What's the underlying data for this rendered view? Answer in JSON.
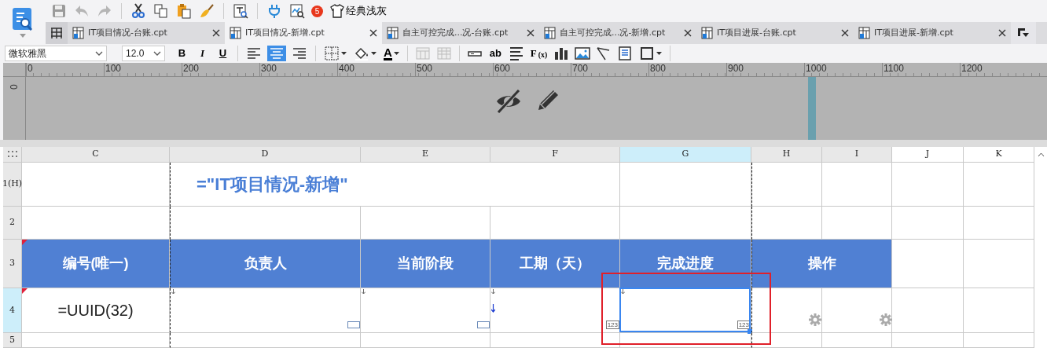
{
  "toolbar": {
    "notification_count": "5",
    "theme_button": "经典浅灰"
  },
  "tabs": [
    {
      "label": "IT项目情况-台账.cpt",
      "selected": false
    },
    {
      "label": "IT项目情况-新增.cpt",
      "selected": true
    },
    {
      "label": "自主可控完成...况-台账.cpt",
      "selected": false
    },
    {
      "label": "自主可控完成...况-新增.cpt",
      "selected": false
    },
    {
      "label": "IT项目进展-台账.cpt",
      "selected": false
    },
    {
      "label": "IT项目进展-新增.cpt",
      "selected": false
    }
  ],
  "format_bar": {
    "font": "微软雅黑",
    "size": "12.0",
    "style_buttons": [
      "B",
      "I",
      "U"
    ],
    "alignment": [
      {
        "kind": "left",
        "selected": false
      },
      {
        "kind": "center",
        "selected": true
      },
      {
        "kind": "right",
        "selected": false
      }
    ],
    "font_color_button": "A",
    "text_button": "ab",
    "formula_button": "F$_{(x)}$"
  },
  "ruler": {
    "horizontal": [
      "0",
      "100",
      "200",
      "300",
      "400",
      "500",
      "600",
      "700",
      "800",
      "900",
      "1000",
      "1100",
      "1200"
    ],
    "vertical": [
      "0"
    ]
  },
  "sheet": {
    "columns": [
      {
        "label": "C",
        "selected": false,
        "shaded": true
      },
      {
        "label": "D",
        "selected": false,
        "shaded": true
      },
      {
        "label": "E",
        "selected": false,
        "shaded": true
      },
      {
        "label": "F",
        "selected": false,
        "shaded": true
      },
      {
        "label": "G",
        "selected": true,
        "shaded": true
      },
      {
        "label": "H",
        "selected": false,
        "shaded": true
      },
      {
        "label": "I",
        "selected": false,
        "shaded": true
      },
      {
        "label": "J",
        "selected": false,
        "shaded": false
      },
      {
        "label": "K",
        "selected": false,
        "shaded": false
      }
    ],
    "rows": [
      {
        "label": "1(H)",
        "selected": false
      },
      {
        "label": "2",
        "selected": false
      },
      {
        "label": "3",
        "selected": false
      },
      {
        "label": "4",
        "selected": true
      },
      {
        "label": "5",
        "selected": false
      }
    ],
    "title": "=\"IT项目情况-新增\"",
    "headers": [
      "编号(唯一)",
      "负责人",
      "当前阶段",
      "工期（天）",
      "完成进度",
      "操作"
    ],
    "formula": "=UUID(32)",
    "widget_tags": [
      "123",
      "123"
    ]
  }
}
